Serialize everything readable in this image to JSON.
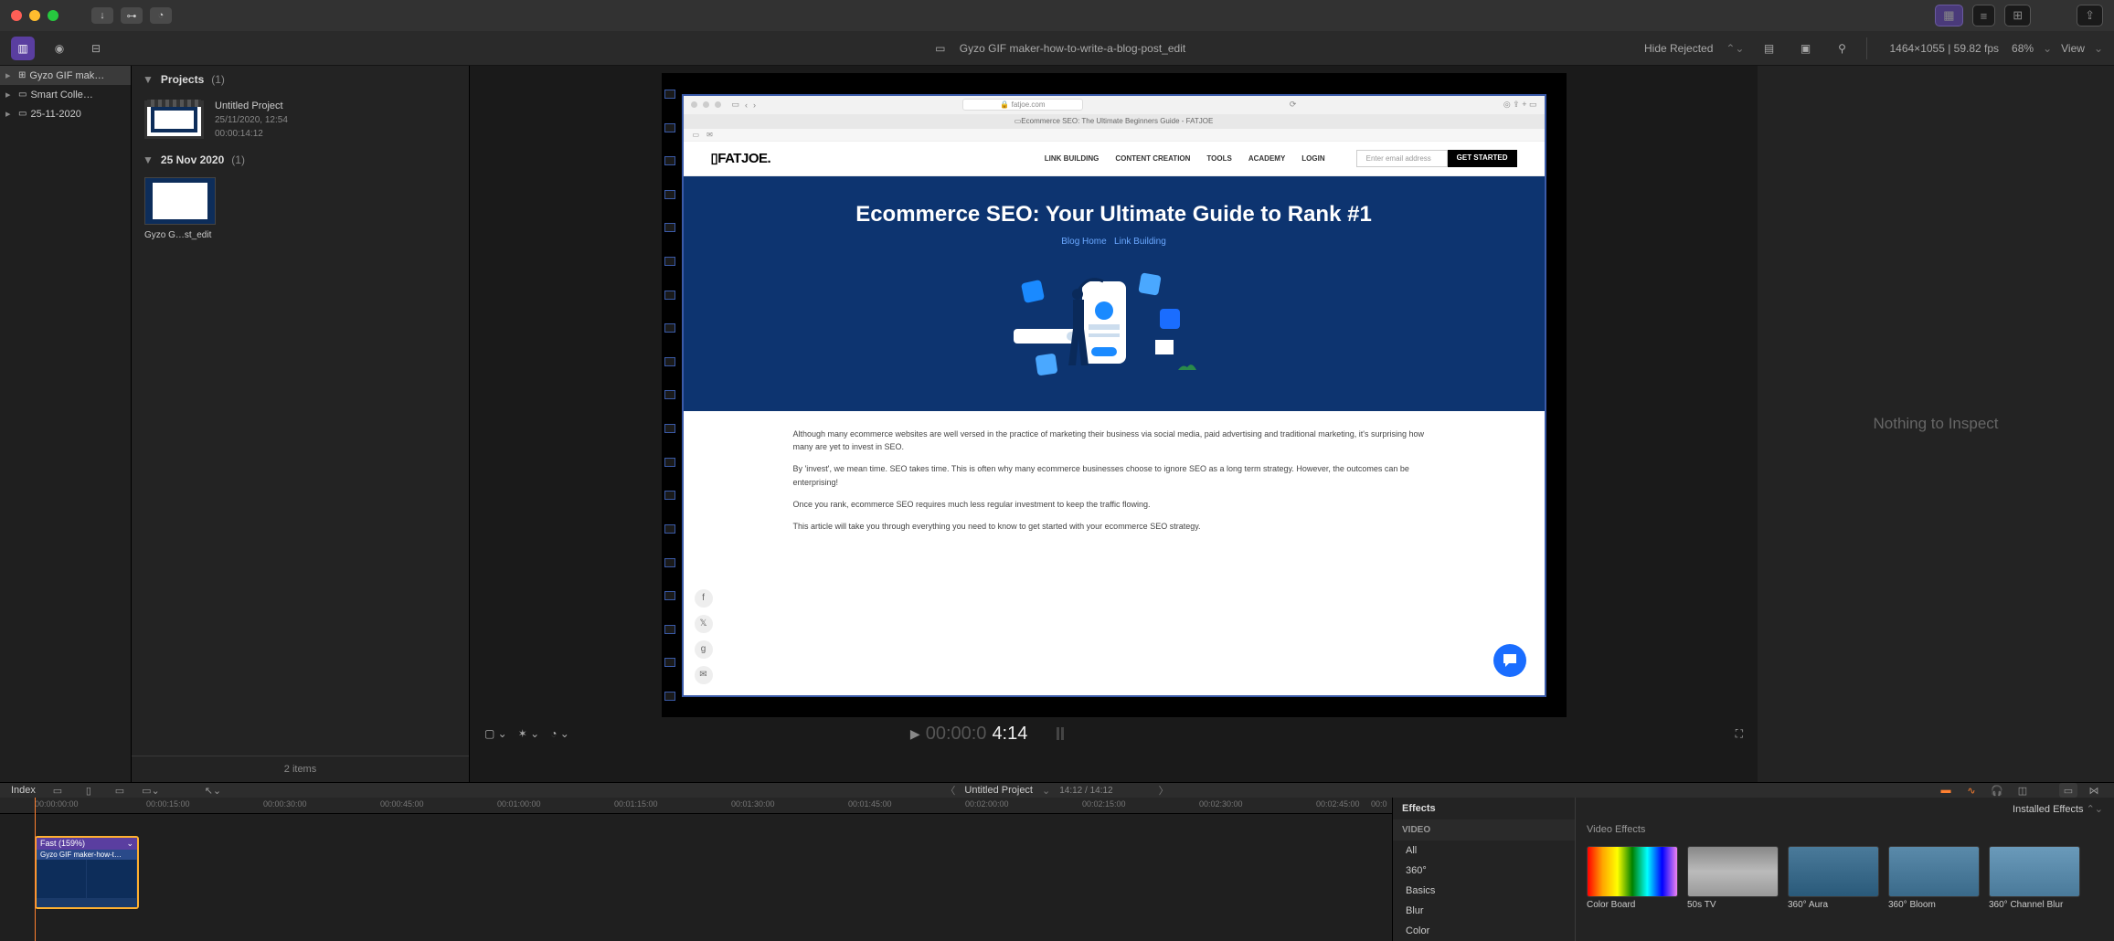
{
  "toolbar": {
    "hide_rejected": "Hide Rejected",
    "media_info": "1464×1055 | 59.82 fps",
    "document_title": "Gyzo GIF maker-how-to-write-a-blog-post_edit",
    "zoom": "68%",
    "view_label": "View"
  },
  "sidebar": {
    "items": [
      {
        "label": "Gyzo GIF mak…",
        "selected": true,
        "icon": "library"
      },
      {
        "label": "Smart Colle…",
        "icon": "folder"
      },
      {
        "label": "25-11-2020",
        "icon": "folder"
      }
    ]
  },
  "browser": {
    "projects_label": "Projects",
    "projects_count": "(1)",
    "project": {
      "title": "Untitled Project",
      "date": "25/11/2020, 12:54",
      "duration": "00:00:14:12"
    },
    "event_label": "25 Nov 2020",
    "event_count": "(1)",
    "clip_name": "Gyzo G…st_edit",
    "footer": "2 items"
  },
  "viewer": {
    "timecode_dim": "00:00:0",
    "timecode_bright": "4:14"
  },
  "webpage": {
    "domain": "fatjoe.com",
    "tab_title": "Ecommerce SEO: The Ultimate Beginners Guide - FATJOE",
    "logo": "▯FATJOE.",
    "nav": [
      "LINK BUILDING",
      "CONTENT CREATION",
      "TOOLS",
      "ACADEMY",
      "LOGIN"
    ],
    "email_placeholder": "Enter email address",
    "cta": "GET STARTED",
    "hero_title": "Ecommerce SEO: Your Ultimate Guide to Rank #1",
    "breadcrumb1": "Blog Home",
    "breadcrumb2": "Link Building",
    "para1": "Although many ecommerce websites are well versed in the practice of marketing their business via social media, paid advertising and traditional marketing, it's surprising how many are yet to invest in SEO.",
    "para2": "By 'invest', we mean time. SEO takes time. This is often why many ecommerce businesses choose to ignore SEO as a long term strategy. However, the outcomes can be enterprising!",
    "para3": "Once you rank, ecommerce SEO requires much less regular investment to keep the traffic flowing.",
    "para4": "This article will take you through everything you need to know to get started with your ecommerce SEO strategy."
  },
  "inspector": {
    "empty": "Nothing to Inspect"
  },
  "timeline": {
    "index_label": "Index",
    "project_name": "Untitled Project",
    "position": "14:12 / 14:12",
    "clip_title": "Fast (159%)",
    "clip_name": "Gyzo GIF maker-how-t…",
    "ruler": [
      "00:00:00:00",
      "00:00:15:00",
      "00:00:30:00",
      "00:00:45:00",
      "00:01:00:00",
      "00:01:15:00",
      "00:01:30:00",
      "00:01:45:00",
      "00:02:00:00",
      "00:02:15:00",
      "00:02:30:00",
      "00:02:45:00",
      "00:0"
    ]
  },
  "effects": {
    "header": "Effects",
    "installed_label": "Installed Effects",
    "video_section": "VIDEO",
    "cats": [
      "All",
      "360°",
      "Basics",
      "Blur",
      "Color"
    ],
    "subhead": "Video Effects",
    "items": [
      "Color Board",
      "50s TV",
      "360° Aura",
      "360° Bloom",
      "360° Channel Blur"
    ]
  }
}
